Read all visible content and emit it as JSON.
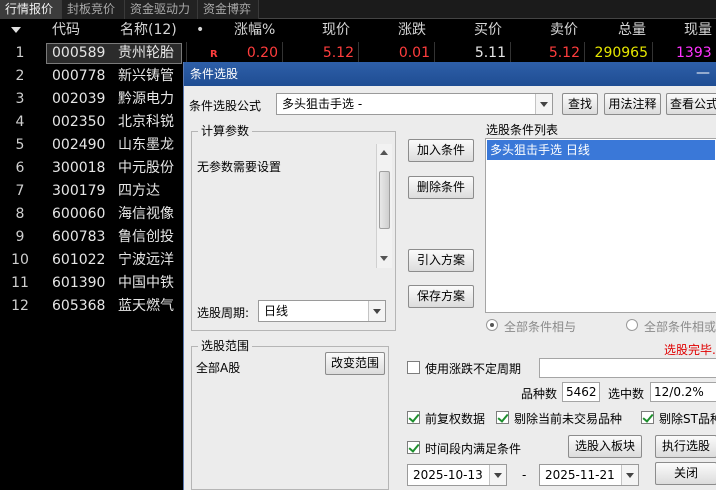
{
  "tabs": [
    "行情报价",
    "封板竞价",
    "资金驱动力",
    "资金博弈"
  ],
  "columns": [
    "代码",
    "名称(12)",
    "•",
    "涨幅%",
    "现价",
    "涨跌",
    "买价",
    "卖价",
    "总量",
    "现量"
  ],
  "rows": [
    {
      "idx": "1",
      "code": "000589",
      "name": "贵州轮胎",
      "badge": "R",
      "change_pct": "0.20",
      "price": "5.12",
      "change": "0.01",
      "bid": "5.11",
      "ask": "5.12",
      "volume": "290965",
      "cur_vol": "1393"
    },
    {
      "idx": "2",
      "code": "000778",
      "name": "新兴铸管"
    },
    {
      "idx": "3",
      "code": "002039",
      "name": "黔源电力"
    },
    {
      "idx": "4",
      "code": "002350",
      "name": "北京科锐"
    },
    {
      "idx": "5",
      "code": "002490",
      "name": "山东墨龙"
    },
    {
      "idx": "6",
      "code": "300018",
      "name": "中元股份"
    },
    {
      "idx": "7",
      "code": "300179",
      "name": "四方达"
    },
    {
      "idx": "8",
      "code": "600060",
      "name": "海信视像"
    },
    {
      "idx": "9",
      "code": "600783",
      "name": "鲁信创投"
    },
    {
      "idx": "10",
      "code": "601022",
      "name": "宁波远洋"
    },
    {
      "idx": "11",
      "code": "601390",
      "name": "中国中铁"
    },
    {
      "idx": "12",
      "code": "605368",
      "name": "蓝天燃气"
    }
  ],
  "dialog": {
    "title": "条件选股",
    "formula_label": "条件选股公式",
    "formula_value": "多头狙击手选  -",
    "find_button": "查找",
    "usage_button": "用法注释",
    "view_formula_button": "查看公式",
    "params_group": "计算参数",
    "params_text": "无参数需要设置",
    "period_label": "选股周期:",
    "period_value": "日线",
    "add_condition": "加入条件",
    "delete_condition": "删除条件",
    "import_plan": "引入方案",
    "save_plan": "保存方案",
    "cond_list_label": "选股条件列表",
    "cond_items": [
      "多头狙击手选  日线"
    ],
    "radio_and": "全部条件相与",
    "radio_or": "全部条件相或",
    "status_text": "选股完毕.",
    "scope_group": "选股范围",
    "scope_value": "全部A股",
    "change_scope": "改变范围",
    "use_variable_period": "使用涨跌不定周期",
    "variable_period_value": "",
    "count_label": "品种数",
    "count_value": "5462",
    "selected_label": "选中数",
    "selected_value": "12/0.2%",
    "fq_label": "前复权数据",
    "exclude_untraded": "剔除当前未交易品种",
    "exclude_st": "剔除ST品种",
    "period_satisfy": "时间段内满足条件",
    "to_block_button": "选股入板块",
    "execute_button": "执行选股",
    "date_from": "2025-10-13",
    "date_sep": "-",
    "date_to": "2025-11-21",
    "close_button": "关闭"
  },
  "colors": {
    "up": "#ff3d3d",
    "volume": "#e6e600",
    "cur_volume": "#ff33ff",
    "title_bar": "#2e5fa8",
    "selection": "#3a78d8",
    "status": "#e00000"
  }
}
